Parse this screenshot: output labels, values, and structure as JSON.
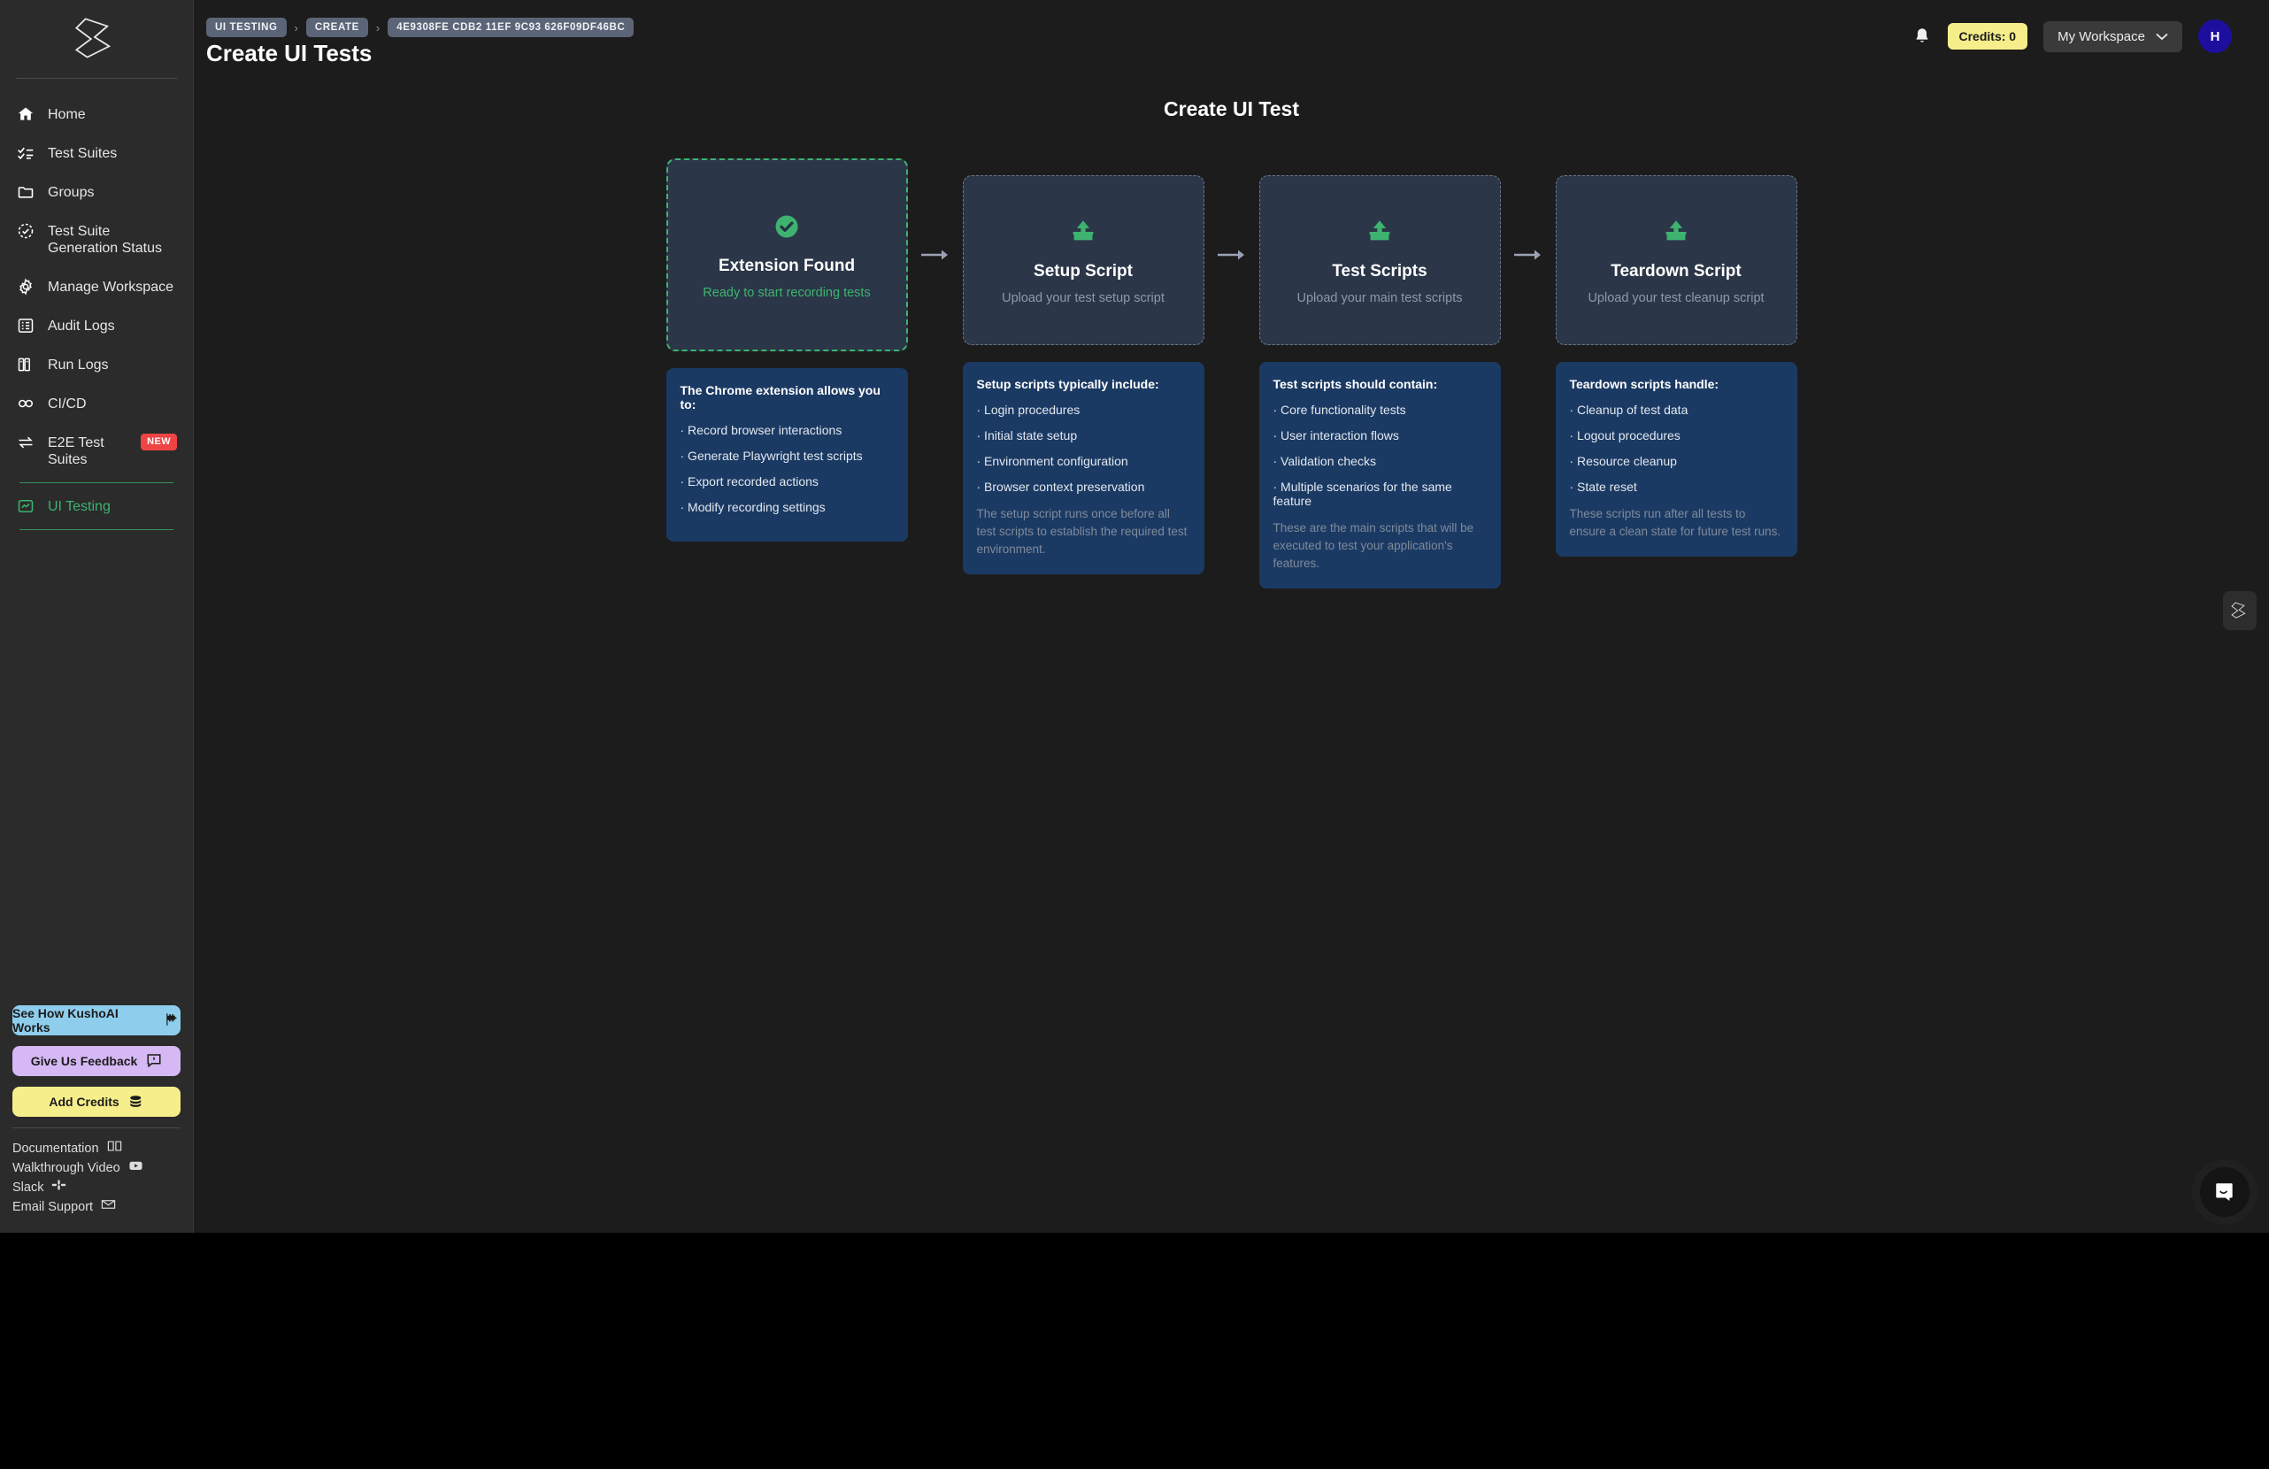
{
  "sidebar": {
    "logo": "kusho-logo",
    "items": [
      {
        "label": "Home",
        "icon": "home-icon"
      },
      {
        "label": "Test Suites",
        "icon": "checklist-icon"
      },
      {
        "label": "Groups",
        "icon": "folder-icon"
      },
      {
        "label": "Test Suite Generation Status",
        "icon": "clock-check-icon"
      },
      {
        "label": "Manage Workspace",
        "icon": "gear-icon"
      },
      {
        "label": "Audit Logs",
        "icon": "list-icon"
      },
      {
        "label": "Run Logs",
        "icon": "books-icon"
      },
      {
        "label": "CI/CD",
        "icon": "infinity-icon"
      },
      {
        "label": "E2E Test Suites",
        "icon": "swap-arrows-icon",
        "badge": "NEW"
      },
      {
        "label": "UI Testing",
        "icon": "chart-box-icon",
        "active": true
      }
    ],
    "buttons": [
      {
        "label": "See How KushoAI Works",
        "icon": "checkered-flag-icon"
      },
      {
        "label": "Give Us Feedback",
        "icon": "feedback-icon"
      },
      {
        "label": "Add Credits",
        "icon": "coins-icon"
      }
    ],
    "links": [
      {
        "label": "Documentation",
        "icon": "book-icon"
      },
      {
        "label": "Walkthrough Video",
        "icon": "youtube-icon"
      },
      {
        "label": "Slack",
        "icon": "slack-icon"
      },
      {
        "label": "Email Support",
        "icon": "envelope-icon"
      }
    ]
  },
  "header": {
    "breadcrumbs": [
      "UI TESTING",
      "CREATE",
      "4E9308FE CDB2 11EF 9C93 626F09DF46BC"
    ],
    "separator": "›",
    "page_title": "Create UI Tests",
    "notifications_icon": "bell-icon",
    "credits_label": "Credits: 0",
    "workspace_label": "My Workspace",
    "workspace_caret": "chevron-down-icon",
    "avatar_initial": "H"
  },
  "main": {
    "title": "Create UI Test",
    "arrow": "→",
    "steps": [
      {
        "id": "extension",
        "icon": "check-circle-icon",
        "title": "Extension Found",
        "subtitle": "Ready to start recording tests",
        "info": {
          "title": "The Chrome extension allows you to:",
          "items": [
            "· Record browser interactions",
            "· Generate Playwright test scripts",
            "· Export recorded actions",
            "· Modify recording settings"
          ],
          "note": ""
        }
      },
      {
        "id": "setup-script",
        "icon": "upload-icon",
        "title": "Setup Script",
        "subtitle": "Upload your test setup script",
        "info": {
          "title": "Setup scripts typically include:",
          "items": [
            "· Login procedures",
            "· Initial state setup",
            "· Environment configuration",
            "· Browser context preservation"
          ],
          "note": "The setup script runs once before all test scripts to establish the required test environment."
        }
      },
      {
        "id": "test-scripts",
        "icon": "upload-icon",
        "title": "Test Scripts",
        "subtitle": "Upload your main test scripts",
        "info": {
          "title": "Test scripts should contain:",
          "items": [
            "· Core functionality tests",
            "· User interaction flows",
            "· Validation checks",
            "· Multiple scenarios for the same feature"
          ],
          "note": "These are the main scripts that will be executed to test your application's features."
        }
      },
      {
        "id": "teardown-script",
        "icon": "upload-icon",
        "title": "Teardown Script",
        "subtitle": "Upload your test cleanup script",
        "info": {
          "title": "Teardown scripts handle:",
          "items": [
            "· Cleanup of test data",
            "· Logout procedures",
            "· Resource cleanup",
            "· State reset"
          ],
          "note": "These scripts run after all tests to ensure a clean state for future test runs."
        }
      }
    ]
  },
  "floating": {
    "side_widget_icon": "kusho-logo-icon",
    "chat_icon": "chat-bubble-icon"
  },
  "colors": {
    "accent_green": "#3eb370",
    "info_blue": "#1b3a63",
    "card_bg": "#2b3648",
    "sidebar_bg": "#2b2b2b",
    "page_bg": "#1c1c1c",
    "badge_red": "#ef4444",
    "credits_yellow": "#f6ee8a",
    "avatar_purple": "#1c0f9e"
  }
}
